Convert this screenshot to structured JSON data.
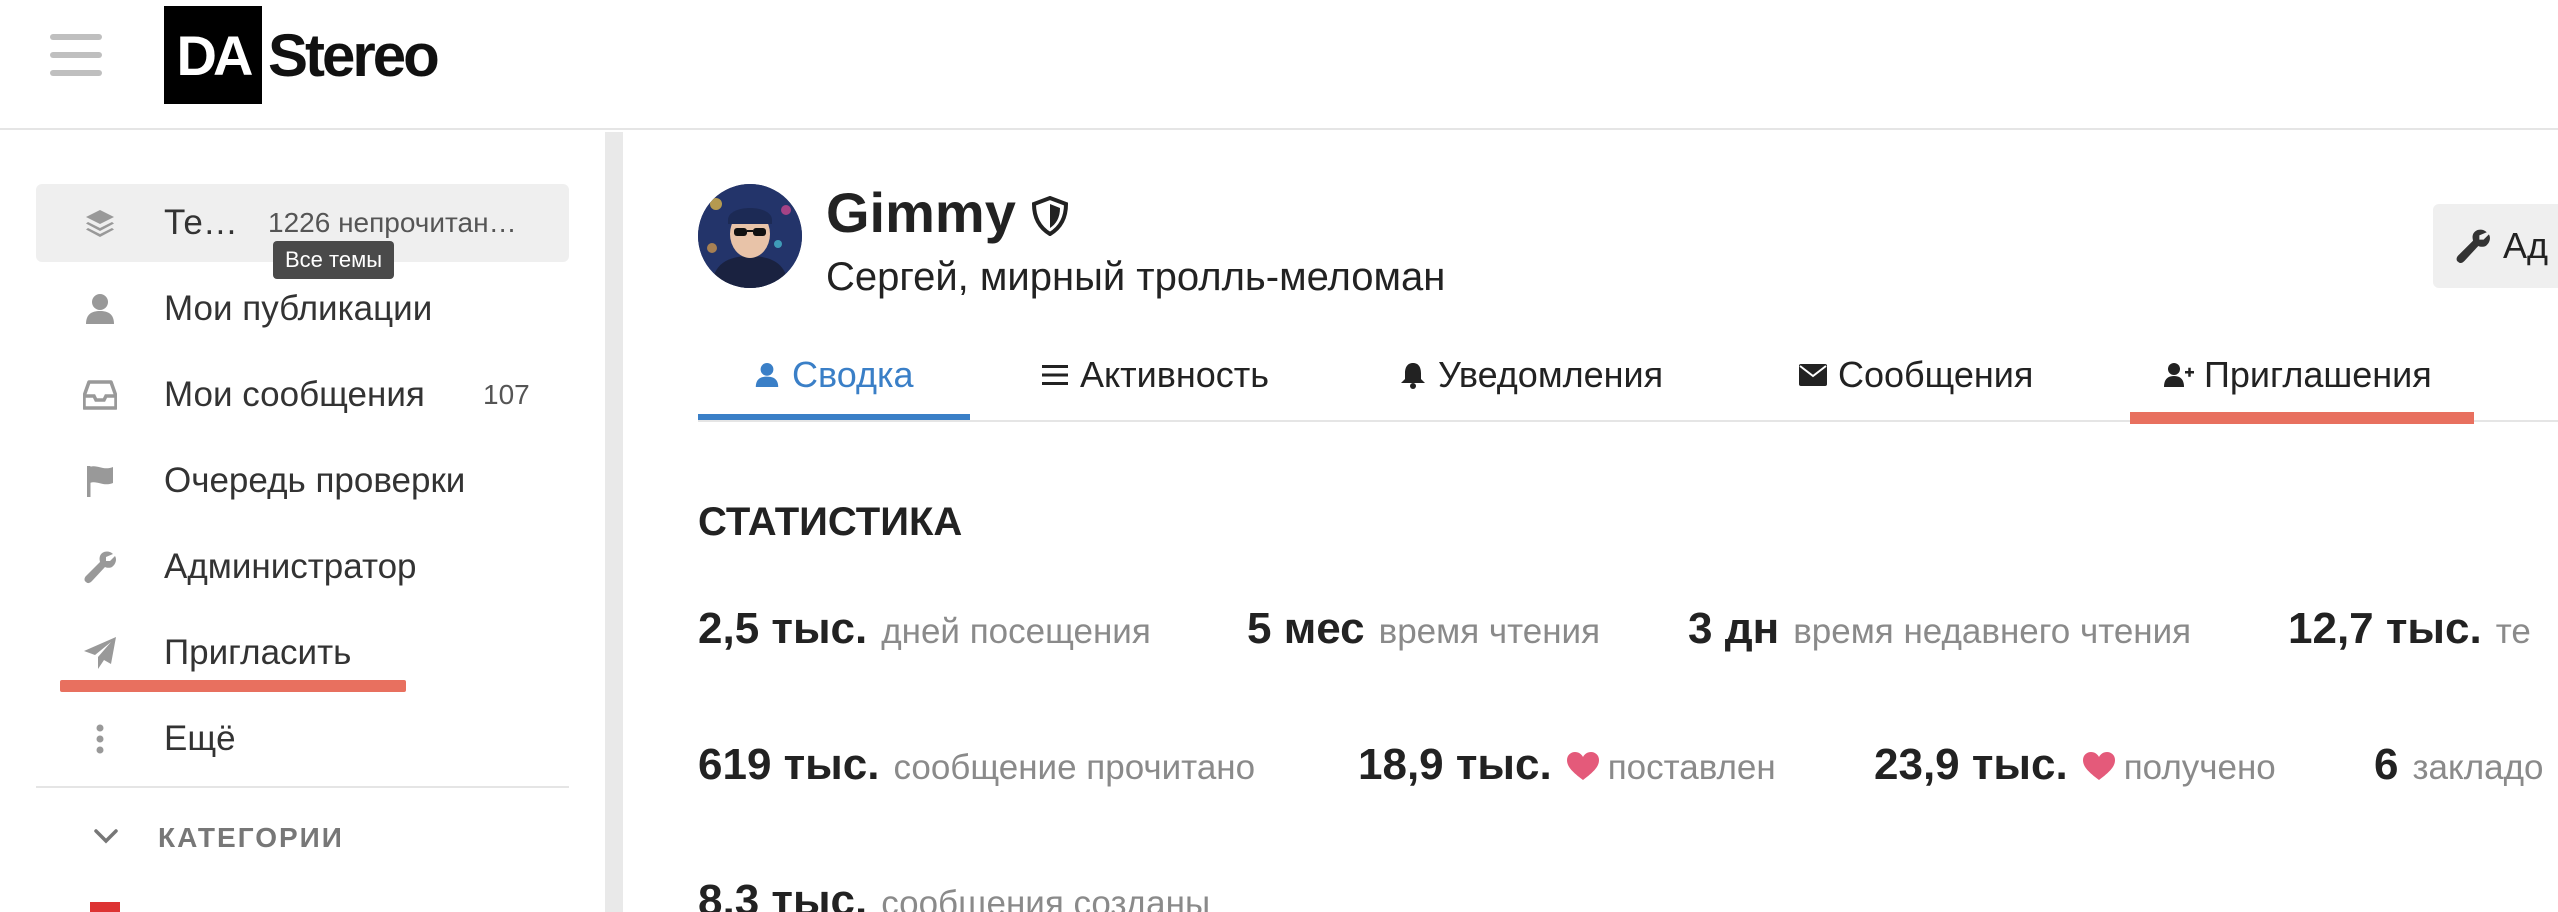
{
  "header": {
    "logo_da": "DA",
    "logo_stereo": "Stereo"
  },
  "sidebar": {
    "items": [
      {
        "label": "Те…",
        "count": "1226 непрочитан…",
        "icon": "layers-icon",
        "active": true
      },
      {
        "label": "Мои публикации",
        "count": "",
        "icon": "user-icon"
      },
      {
        "label": "Мои сообщения",
        "count": "107",
        "icon": "inbox-icon"
      },
      {
        "label": "Очередь проверки",
        "count": "",
        "icon": "flag-icon"
      },
      {
        "label": "Администратор",
        "count": "",
        "icon": "wrench-icon"
      },
      {
        "label": "Пригласить",
        "count": "",
        "icon": "paper-plane-icon"
      },
      {
        "label": "Ещё",
        "count": "",
        "icon": "ellipsis-vertical-icon"
      }
    ],
    "tooltip": "Все темы",
    "categories_title": "КАТЕГОРИИ"
  },
  "profile": {
    "username": "Gimmy",
    "full_name": "Сергей, мирный тролль-меломан",
    "admin_button": "Ад"
  },
  "tabs": [
    {
      "label": "Сводка",
      "icon": "user-icon",
      "active": true
    },
    {
      "label": "Активность",
      "icon": "list-icon"
    },
    {
      "label": "Уведомления",
      "icon": "bell-icon"
    },
    {
      "label": "Сообщения",
      "icon": "envelope-icon"
    },
    {
      "label": "Приглашения",
      "icon": "user-plus-icon"
    }
  ],
  "stats": {
    "title": "СТАТИСТИКА",
    "row1": [
      {
        "value": "2,5 тыс.",
        "label": "дней посещения"
      },
      {
        "value": "5 мес",
        "label": "время чтения"
      },
      {
        "value": "3 дн",
        "label": "время недавнего чтения"
      },
      {
        "value": "12,7 тыс.",
        "label": "те"
      }
    ],
    "row2": [
      {
        "value": "619 тыс.",
        "label": "сообщение прочитано"
      },
      {
        "value": "18,9 тыс.",
        "label": "поставлен"
      },
      {
        "value": "23,9 тыс.",
        "label": "получено"
      },
      {
        "value": "6",
        "label": "закладо"
      }
    ],
    "row3": [
      {
        "value": "8,3 тыс.",
        "label": "сообщения созданы"
      }
    ]
  },
  "colors": {
    "accent_blue": "#3a7fc7",
    "highlight_red": "#e8705f",
    "heart_pink": "#e45a7a"
  }
}
